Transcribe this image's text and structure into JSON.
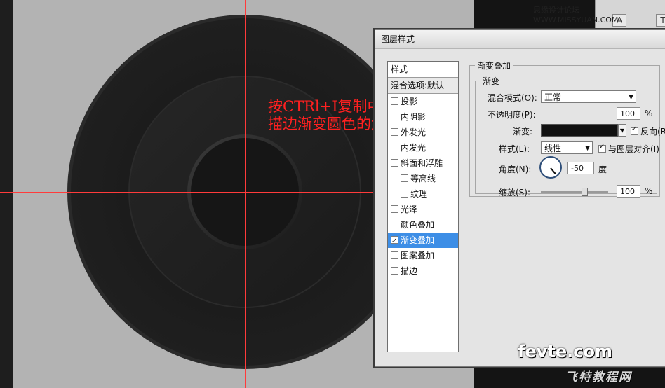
{
  "watermark_top": "思缘设计论坛 WWW.MISSYUAN.COM",
  "annotation": {
    "line1": "按CTRl+I复制中间那个圆，然后缩小一点，最后把",
    "line2": "描边渐变圆色的角度调一下"
  },
  "toolbar": {
    "text_tool": "A",
    "type_icon": "T"
  },
  "dialog": {
    "title": "图层样式",
    "list": {
      "styles_header": "样式",
      "blending_options": "混合选项:默认",
      "items": [
        {
          "label": "投影",
          "checked": false,
          "sub": false
        },
        {
          "label": "内阴影",
          "checked": false,
          "sub": false
        },
        {
          "label": "外发光",
          "checked": false,
          "sub": false
        },
        {
          "label": "内发光",
          "checked": false,
          "sub": false
        },
        {
          "label": "斜面和浮雕",
          "checked": false,
          "sub": false
        },
        {
          "label": "等高线",
          "checked": false,
          "sub": true
        },
        {
          "label": "纹理",
          "checked": false,
          "sub": true
        },
        {
          "label": "光泽",
          "checked": false,
          "sub": false
        },
        {
          "label": "颜色叠加",
          "checked": false,
          "sub": false
        },
        {
          "label": "渐变叠加",
          "checked": true,
          "sub": false,
          "selected": true
        },
        {
          "label": "图案叠加",
          "checked": false,
          "sub": false
        },
        {
          "label": "描边",
          "checked": false,
          "sub": false
        }
      ]
    },
    "panel": {
      "section_title": "渐变叠加",
      "group_title": "渐变",
      "blend_mode_label": "混合模式(O):",
      "blend_mode_value": "正常",
      "opacity_label": "不透明度(P):",
      "opacity_value": "100",
      "opacity_unit": "%",
      "gradient_label": "渐变:",
      "reverse_label": "反向(R)",
      "reverse_checked": true,
      "style_label": "样式(L):",
      "style_value": "线性",
      "align_label": "与图层对齐(I)",
      "align_checked": true,
      "angle_label": "角度(N):",
      "angle_value": "-50",
      "angle_unit": "度",
      "scale_label": "缩放(S):",
      "scale_value": "100",
      "scale_unit": "%"
    }
  },
  "brand": {
    "name": "fevte.com",
    "sub": "飞特教程网"
  },
  "colors": {
    "guide": "#ff3b3b",
    "selected": "#3d8ee6",
    "annotation": "#ff2020"
  }
}
